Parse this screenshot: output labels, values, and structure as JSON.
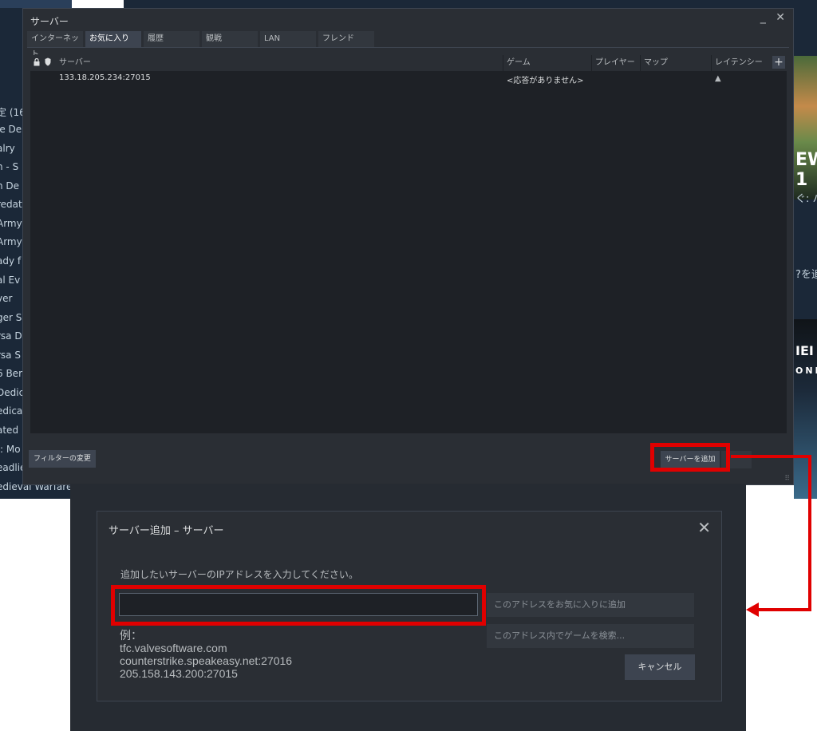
{
  "background": {
    "library_items": [
      "定 (16",
      "ie De",
      "alry",
      "n - S",
      "n De",
      "redat",
      "Army",
      "Army:",
      "ady f",
      "al Ev",
      "ver",
      "ger S",
      "rsa D",
      "rsa S",
      "6 Ber",
      "Dedic",
      "edica",
      "ated",
      "/: Mo",
      "eadlie",
      "edieval Warfare"
    ],
    "store_texts": [
      "EW 1",
      "ぐ: ハ",
      "?を追",
      "IEI",
      "ONI"
    ]
  },
  "servers_window": {
    "title": "サーバー",
    "minimize": "_",
    "close": "✕",
    "tabs": [
      "インターネット",
      "お気に入り",
      "履歴",
      "観戦",
      "LAN",
      "フレンド"
    ],
    "active_tab": "お気に入り",
    "columns": {
      "server": "サーバー",
      "game": "ゲーム",
      "players": "プレイヤー",
      "map": "マップ",
      "latency": "レイテンシー ▲",
      "add": "+"
    },
    "rows": [
      {
        "server": "133.18.205.234:27015",
        "game": "<応答がありません>"
      }
    ],
    "filter_button": "フィルターの変更",
    "add_server_button": "サーバーを追加"
  },
  "add_server_dialog": {
    "title": "サーバー追加 – サーバー",
    "close": "✕",
    "prompt": "追加したいサーバーのIPアドレスを入力してください。",
    "input_value": "",
    "add_favorite_button": "このアドレスをお気に入りに追加",
    "search_games_button": "このアドレス内でゲームを検索...",
    "cancel_button": "キャンセル",
    "examples_label": "例：",
    "examples": [
      "tfc.valvesoftware.com",
      "counterstrike.speakeasy.net:27016",
      "205.158.143.200:27015"
    ]
  },
  "colors": {
    "highlight": "#e00000",
    "window_bg": "#2a2e34",
    "list_bg": "#1e2126"
  }
}
